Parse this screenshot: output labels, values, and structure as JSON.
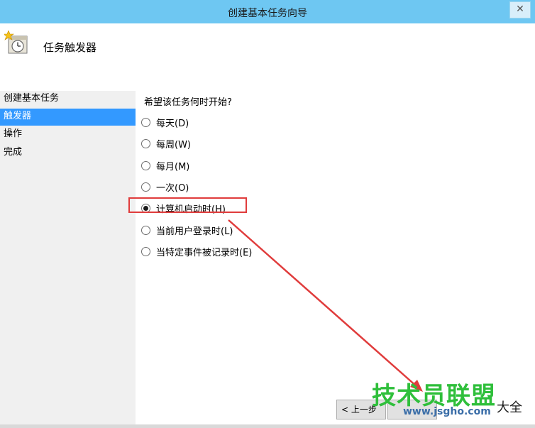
{
  "window": {
    "title": "创建基本任务向导",
    "close_glyph": "✕"
  },
  "header": {
    "heading": "任务触发器"
  },
  "sidebar": {
    "items": [
      {
        "label": "创建基本任务",
        "active": false
      },
      {
        "label": "触发器",
        "active": true
      },
      {
        "label": "操作",
        "active": false
      },
      {
        "label": "完成",
        "active": false
      }
    ]
  },
  "main": {
    "question": "希望该任务何时开始?",
    "options": [
      {
        "label": "每天(D)",
        "checked": false
      },
      {
        "label": "每周(W)",
        "checked": false
      },
      {
        "label": "每月(M)",
        "checked": false
      },
      {
        "label": "一次(O)",
        "checked": false
      },
      {
        "label": "计算机启动时(H)",
        "checked": true
      },
      {
        "label": "当前用户登录时(L)",
        "checked": false
      },
      {
        "label": "当特定事件被记录时(E)",
        "checked": false
      }
    ]
  },
  "buttons": {
    "back_label": "< 上一步"
  },
  "watermark": {
    "brand": "技术员联盟",
    "url": "www.jsgho.com",
    "side_text": "大全"
  },
  "colors": {
    "titlebar": "#6ec7f2",
    "selection": "#3399ff",
    "annotation": "#e03c3c",
    "watermark": "#2fbf3b"
  },
  "icons": {
    "app": "task-scheduler-clock-icon",
    "close": "close-icon"
  }
}
